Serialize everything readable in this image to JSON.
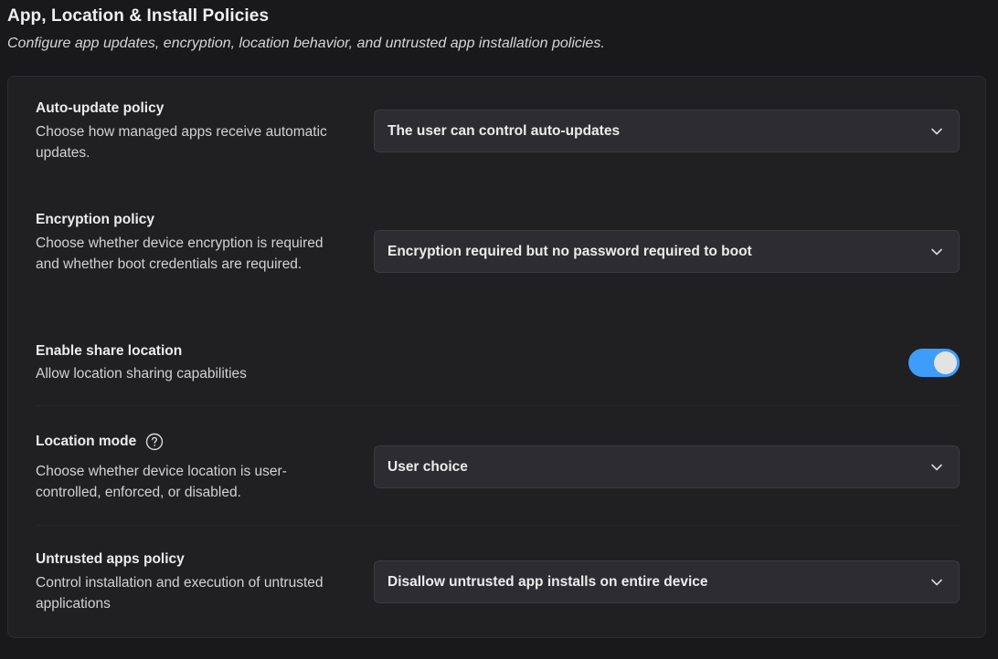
{
  "header": {
    "title": "App, Location & Install Policies",
    "subtitle": "Configure app updates, encryption, location behavior, and untrusted app installation policies."
  },
  "policies": {
    "auto_update": {
      "title": "Auto-update policy",
      "description": "Choose how managed apps receive automatic updates.",
      "selected": "The user can control auto-updates"
    },
    "encryption": {
      "title": "Encryption policy",
      "description": "Choose whether device encryption is required and whether boot credentials are required.",
      "selected": "Encryption required but no password required to boot"
    },
    "share_location": {
      "title": "Enable share location",
      "description": "Allow location sharing capabilities",
      "enabled": true
    },
    "location_mode": {
      "title": "Location mode",
      "description": "Choose whether device location is user-controlled, enforced, or disabled.",
      "selected": "User choice",
      "help_icon": "question-circle-icon"
    },
    "untrusted_apps": {
      "title": "Untrusted apps policy",
      "description": "Control installation and execution of untrusted applications",
      "selected": "Disallow untrusted app installs on entire device"
    }
  },
  "colors": {
    "background": "#19191b",
    "card": "#202023",
    "select": "#2d2d31",
    "toggle_on": "#3e9dfb"
  }
}
